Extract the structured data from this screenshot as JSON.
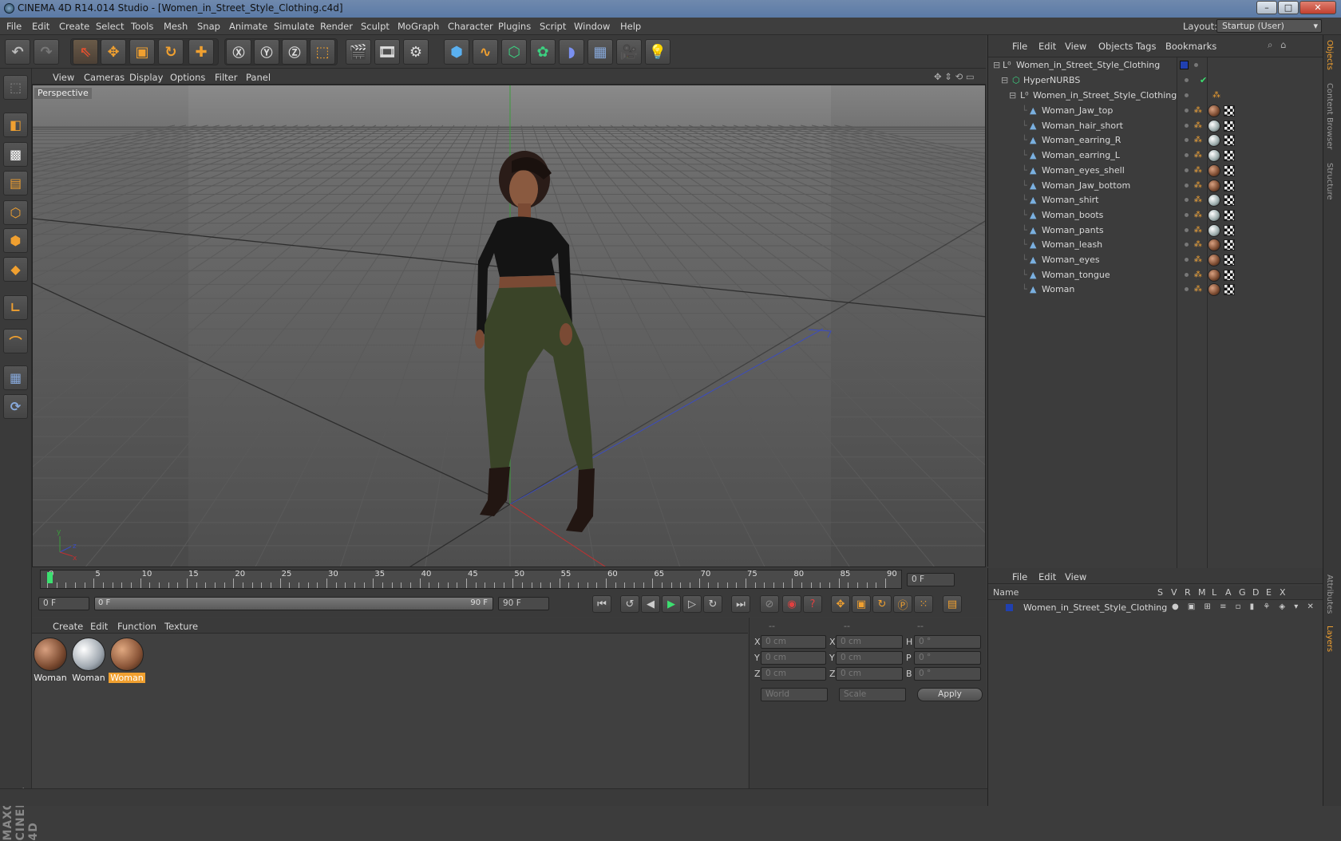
{
  "window": {
    "title": "CINEMA 4D R14.014 Studio - [Women_in_Street_Style_Clothing.c4d]",
    "buttons": [
      "–",
      "□",
      "✕"
    ]
  },
  "menubar": {
    "items": [
      "File",
      "Edit",
      "Create",
      "Select",
      "Tools",
      "Mesh",
      "Snap",
      "Animate",
      "Simulate",
      "Render",
      "Sculpt",
      "MoGraph",
      "Character",
      "Plugins",
      "Script",
      "Window",
      "Help"
    ],
    "layout_label": "Layout:",
    "layout_value": "Startup (User)"
  },
  "viewport": {
    "menu": [
      "View",
      "Cameras",
      "Display",
      "Options",
      "Filter",
      "Panel"
    ],
    "label": "Perspective"
  },
  "timeline": {
    "ticks": [
      "0",
      "5",
      "10",
      "15",
      "20",
      "25",
      "30",
      "35",
      "40",
      "45",
      "50",
      "55",
      "60",
      "65",
      "70",
      "75",
      "80",
      "85",
      "90"
    ],
    "current": "0 F",
    "start": "0 F",
    "slider_start": "0 F",
    "slider_end": "90 F",
    "end": "90 F"
  },
  "materials": {
    "menu": [
      "Create",
      "Edit",
      "Function",
      "Texture"
    ],
    "items": [
      {
        "label": "Woman",
        "color": "#7a4a30"
      },
      {
        "label": "Woman",
        "color": "#a0a8b0"
      },
      {
        "label": "Woman",
        "color": "#8a5538",
        "selected": true
      }
    ]
  },
  "coords": {
    "header": [
      "--",
      "--",
      "--"
    ],
    "rows": [
      {
        "a": "X",
        "av": "0 cm",
        "b": "X",
        "bv": "0 cm",
        "c": "H",
        "cv": "0 °"
      },
      {
        "a": "Y",
        "av": "0 cm",
        "b": "Y",
        "bv": "0 cm",
        "c": "P",
        "cv": "0 °"
      },
      {
        "a": "Z",
        "av": "0 cm",
        "b": "Z",
        "bv": "0 cm",
        "c": "B",
        "cv": "0 °"
      }
    ],
    "world": "World",
    "scale": "Scale",
    "apply": "Apply"
  },
  "objects": {
    "menu": [
      "File",
      "Edit",
      "View",
      "Objects",
      "Tags",
      "Bookmarks"
    ],
    "root": "Women_in_Street_Style_Clothing",
    "nurbs": "HyperNURBS",
    "group": "Women_in_Street_Style_Clothing",
    "items": [
      "Woman_Jaw_top",
      "Woman_hair_short",
      "Woman_earring_R",
      "Woman_earring_L",
      "Woman_eyes_shell",
      "Woman_Jaw_bottom",
      "Woman_shirt",
      "Woman_boots",
      "Woman_pants",
      "Woman_leash",
      "Woman_eyes",
      "Woman_tongue",
      "Woman"
    ]
  },
  "layers": {
    "menu": [
      "File",
      "Edit",
      "View"
    ],
    "columns": [
      "Name",
      "S",
      "V",
      "R",
      "M",
      "L",
      "A",
      "G",
      "D",
      "E",
      "X"
    ],
    "row": "Women_in_Street_Style_Clothing"
  },
  "side_tabs": [
    "Objects",
    "Content Browser",
    "Structure",
    "Attributes",
    "Layers"
  ],
  "brand": "MAXON CINEMA 4D"
}
